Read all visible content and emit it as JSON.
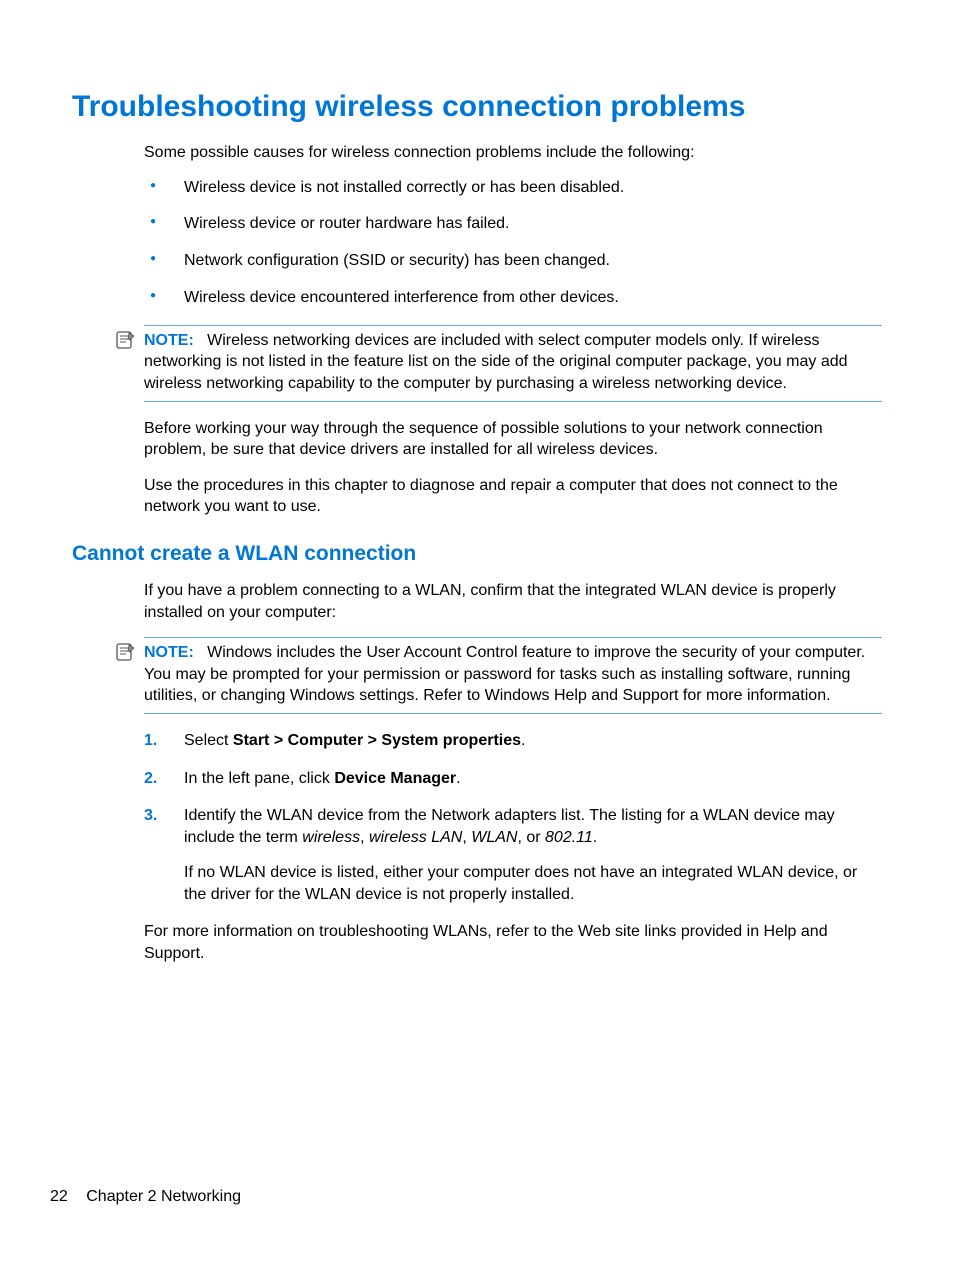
{
  "heading1": "Troubleshooting wireless connection problems",
  "intro": "Some possible causes for wireless connection problems include the following:",
  "causes": [
    "Wireless device is not installed correctly or has been disabled.",
    "Wireless device or router hardware has failed.",
    "Network configuration (SSID or security) has been changed.",
    "Wireless device encountered interference from other devices."
  ],
  "note1": {
    "label": "NOTE:",
    "text": "Wireless networking devices are included with select computer models only. If wireless networking is not listed in the feature list on the side of the original computer package, you may add wireless networking capability to the computer by purchasing a wireless networking device."
  },
  "para_before": "Before working your way through the sequence of possible solutions to your network connection problem, be sure that device drivers are installed for all wireless devices.",
  "para_use": "Use the procedures in this chapter to diagnose and repair a computer that does not connect to the network you want to use.",
  "heading2": "Cannot create a WLAN connection",
  "para_cc": "If you have a problem connecting to a WLAN, confirm that the integrated WLAN device is properly installed on your computer:",
  "note2": {
    "label": "NOTE:",
    "text": "Windows includes the User Account Control feature to improve the security of your computer. You may be prompted for your permission or password for tasks such as installing software, running utilities, or changing Windows settings. Refer to Windows Help and Support for more information."
  },
  "steps": {
    "s1_pre": "Select ",
    "s1_bold": "Start > Computer > System properties",
    "s1_post": ".",
    "s2_pre": "In the left pane, click ",
    "s2_bold": "Device Manager",
    "s2_post": ".",
    "s3_pre": "Identify the WLAN device from the Network adapters list. The listing for a WLAN device may include the term ",
    "s3_i1": "wireless",
    "s3_c1": ", ",
    "s3_i2": "wireless LAN",
    "s3_c2": ", ",
    "s3_i3": "WLAN",
    "s3_c3": ", or ",
    "s3_i4": "802.11",
    "s3_post": ".",
    "s3_sub": "If no WLAN device is listed, either your computer does not have an integrated WLAN device, or the driver for the WLAN device is not properly installed."
  },
  "para_more": "For more information on troubleshooting WLANs, refer to the Web site links provided in Help and Support.",
  "footer": {
    "page": "22",
    "chapter": "Chapter 2   Networking"
  }
}
